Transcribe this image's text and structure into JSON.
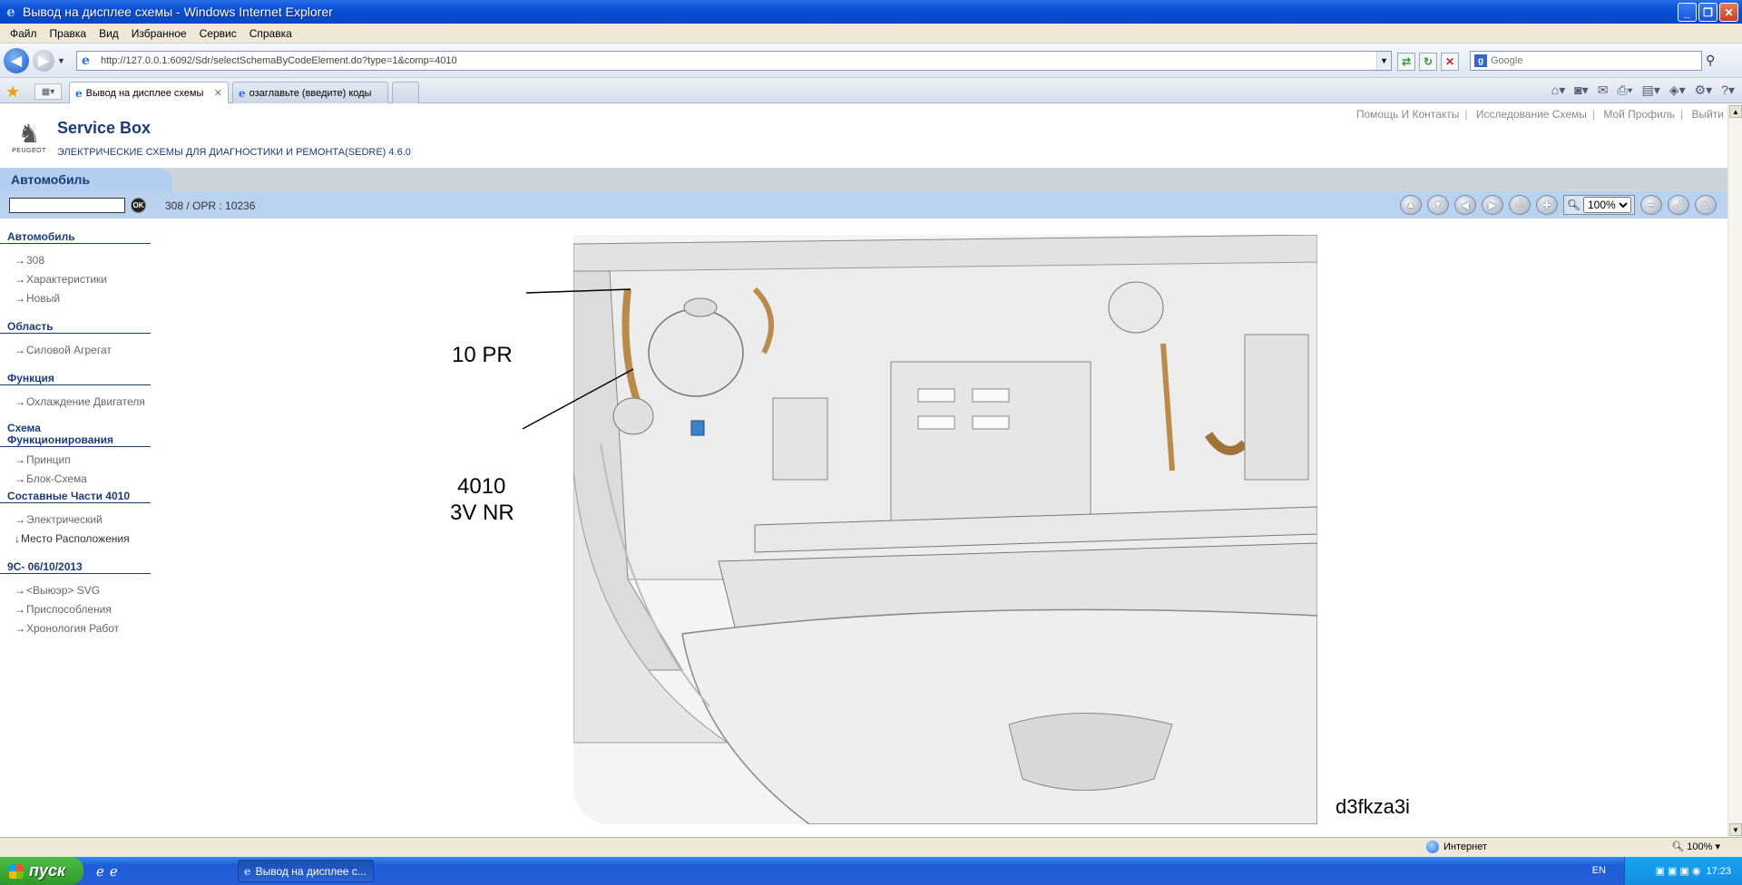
{
  "window": {
    "title": "Вывод на дисплее схемы - Windows Internet Explorer"
  },
  "menu": [
    "Файл",
    "Правка",
    "Вид",
    "Избранное",
    "Сервис",
    "Справка"
  ],
  "address": {
    "url": "http://127.0.0.1:6092/Sdr/selectSchemaByCodeElement.do?type=1&comp=4010"
  },
  "search": {
    "placeholder": "Google"
  },
  "tabs": [
    {
      "label": "Вывод на дисплее схемы"
    },
    {
      "label": "озаглавьте (введите) коды"
    }
  ],
  "header": {
    "links": [
      "Помощь И Контакты",
      "Исследование Схемы",
      "Мой Профиль",
      "Выйти"
    ],
    "brand": "PEUGEOT",
    "title": "Service Box",
    "subtitle": "ЭЛЕКТРИЧЕСКИЕ СХЕМЫ ДЛЯ ДИАГНОСТИКИ И РЕМОНТА(SEDRE) 4.6.0"
  },
  "section": {
    "title": "Автомобиль"
  },
  "toolbar": {
    "ok": "OK",
    "crumb": "308  /  OPR : 10236",
    "zoom": "100%"
  },
  "sidebar": [
    {
      "title": "Автомобиль",
      "items": [
        {
          "arrow": "→",
          "label": "308"
        },
        {
          "arrow": "→",
          "label": "Характеристики"
        },
        {
          "arrow": "→",
          "label": "Новый"
        }
      ]
    },
    {
      "title": "Область",
      "items": [
        {
          "arrow": "→",
          "label": "Силовой Агрегат"
        }
      ]
    },
    {
      "title": "Функция",
      "items": [
        {
          "arrow": "→",
          "label": "Охлаждение Двигателя"
        }
      ]
    },
    {
      "title": "Схема Функционирования",
      "items": [
        {
          "arrow": "→",
          "label": "Принцип"
        },
        {
          "arrow": "→",
          "label": "Блок-Схема"
        }
      ]
    },
    {
      "title": "Составные Части 4010",
      "items": [
        {
          "arrow": "→",
          "label": "Электрический"
        },
        {
          "arrow": "↓",
          "label": "Место Расположения"
        }
      ]
    },
    {
      "title": "9C- 06/10/2013",
      "items": [
        {
          "arrow": "→",
          "label": "<Выюэр> SVG"
        },
        {
          "arrow": "→",
          "label": "Приспособления"
        },
        {
          "arrow": "→",
          "label": "Хронология Работ"
        }
      ]
    }
  ],
  "diagram": {
    "callout1": "10 PR",
    "callout2_line1": "4010",
    "callout2_line2": "3V NR",
    "ref": "d3fkza3i"
  },
  "status": {
    "zone": "Интернет",
    "zoom": "100%"
  },
  "taskbar": {
    "start": "пуск",
    "item": "Вывод на дисплее с...",
    "lang": "EN",
    "clock": "17:23"
  }
}
